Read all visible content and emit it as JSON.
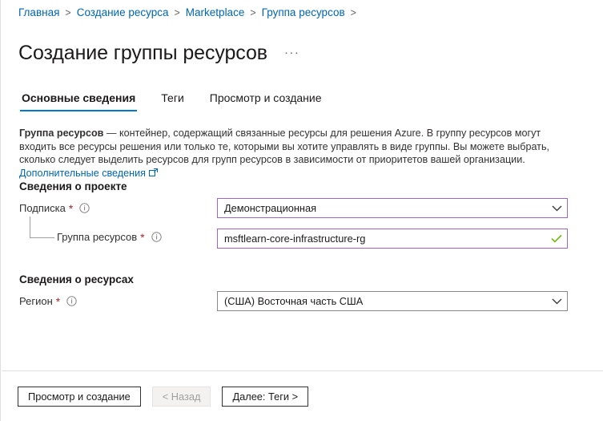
{
  "breadcrumb": {
    "separator": ">",
    "items": [
      {
        "label": "Главная"
      },
      {
        "label": "Создание ресурса"
      },
      {
        "label": "Marketplace"
      },
      {
        "label": "Группа ресурсов"
      }
    ]
  },
  "header": {
    "title": "Создание группы ресурсов",
    "more_menu": "···"
  },
  "tabs": [
    {
      "label": "Основные сведения",
      "active": true
    },
    {
      "label": "Теги",
      "active": false
    },
    {
      "label": "Просмотр и создание",
      "active": false
    }
  ],
  "description": {
    "lead": "Группа ресурсов",
    "dash": " — ",
    "body": "контейнер, содержащий связанные ресурсы для решения Azure. В группу ресурсов могут входить все ресурсы решения или только те, которыми вы хотите управлять в виде группы. Вы можете выбрать, сколько следует выделить ресурсов для групп ресурсов в зависимости от приоритетов вашей организации.",
    "learn_more": "Дополнительные сведения"
  },
  "form": {
    "project_section": "Сведения о проекте",
    "resource_section": "Сведения о ресурсах",
    "required_mark": "*",
    "subscription": {
      "label": "Подписка",
      "value": "Демонстрационная",
      "border_color": "#9a67c9"
    },
    "resource_group": {
      "label": "Группа ресурсов",
      "value": "msftlearn-core-infrastructure-rg",
      "border_color": "#9a67c9",
      "valid": true
    },
    "region": {
      "label": "Регион",
      "value": "(США) Восточная часть США",
      "border_color": "#8a8886"
    }
  },
  "footer": {
    "review_create": "Просмотр и создание",
    "previous": "< Назад",
    "next": "Далее: Теги >"
  },
  "colors": {
    "accent_blue": "#0078d4",
    "link_blue": "#0065b3",
    "required_red": "#a4262c",
    "valid_green": "#6bb700",
    "field_purple": "#9a67c9"
  }
}
